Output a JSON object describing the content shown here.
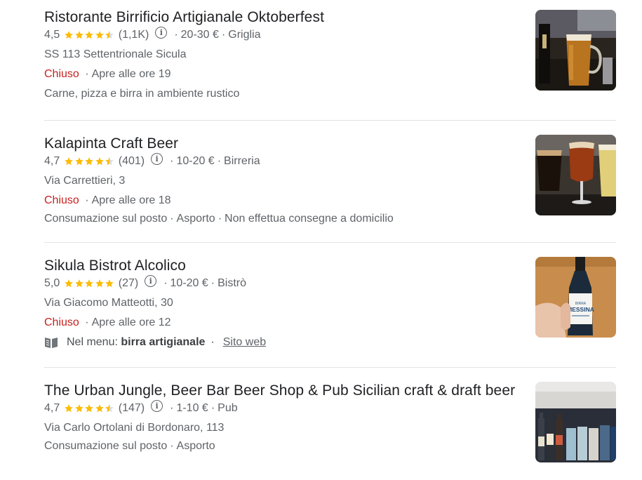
{
  "results": [
    {
      "name": "Ristorante Birrificio Artigianale Oktoberfest",
      "rating": "4,5",
      "stars": 4.5,
      "reviews": "(1,1K)",
      "price": "20-30 €",
      "category": "Griglia",
      "address": "SS 113 Settentrionale Sicula",
      "status": "Chiuso",
      "hours": "Apre alle ore 19",
      "description": "Carne, pizza e birra in ambiente rustico"
    },
    {
      "name": "Kalapinta Craft Beer",
      "rating": "4,7",
      "stars": 4.5,
      "reviews": "(401)",
      "price": "10-20 €",
      "category": "Birreria",
      "address": "Via Carrettieri, 3",
      "status": "Chiuso",
      "hours": "Apre alle ore 18",
      "services": [
        "Consumazione sul posto",
        "Asporto",
        "Non effettua consegne a domicilio"
      ]
    },
    {
      "name": "Sikula Bistrot Alcolico",
      "rating": "5,0",
      "stars": 5,
      "reviews": "(27)",
      "price": "10-20 €",
      "category": "Bistrò",
      "address": "Via Giacomo Matteotti, 30",
      "status": "Chiuso",
      "hours": "Apre alle ore 12",
      "menu_prefix": "Nel menu:",
      "menu_item": "birra artigianale",
      "website_label": "Sito web",
      "image_label": "BIRRA MESSINA"
    },
    {
      "name": "The Urban Jungle, Beer Bar Beer Shop & Pub Sicilian craft & draft beer",
      "rating": "4,7",
      "stars": 4.5,
      "reviews": "(147)",
      "price": "1-10 €",
      "category": "Pub",
      "address": "Via Carlo Ortolani di Bordonaro, 113",
      "services": [
        "Consumazione sul posto",
        "Asporto"
      ]
    }
  ],
  "icons": {
    "info": "info-circle-icon",
    "star": "star-icon",
    "menu": "menu-book-icon"
  },
  "colors": {
    "star": "#fbbc04",
    "closed": "#c5221f",
    "title": "#202124"
  }
}
